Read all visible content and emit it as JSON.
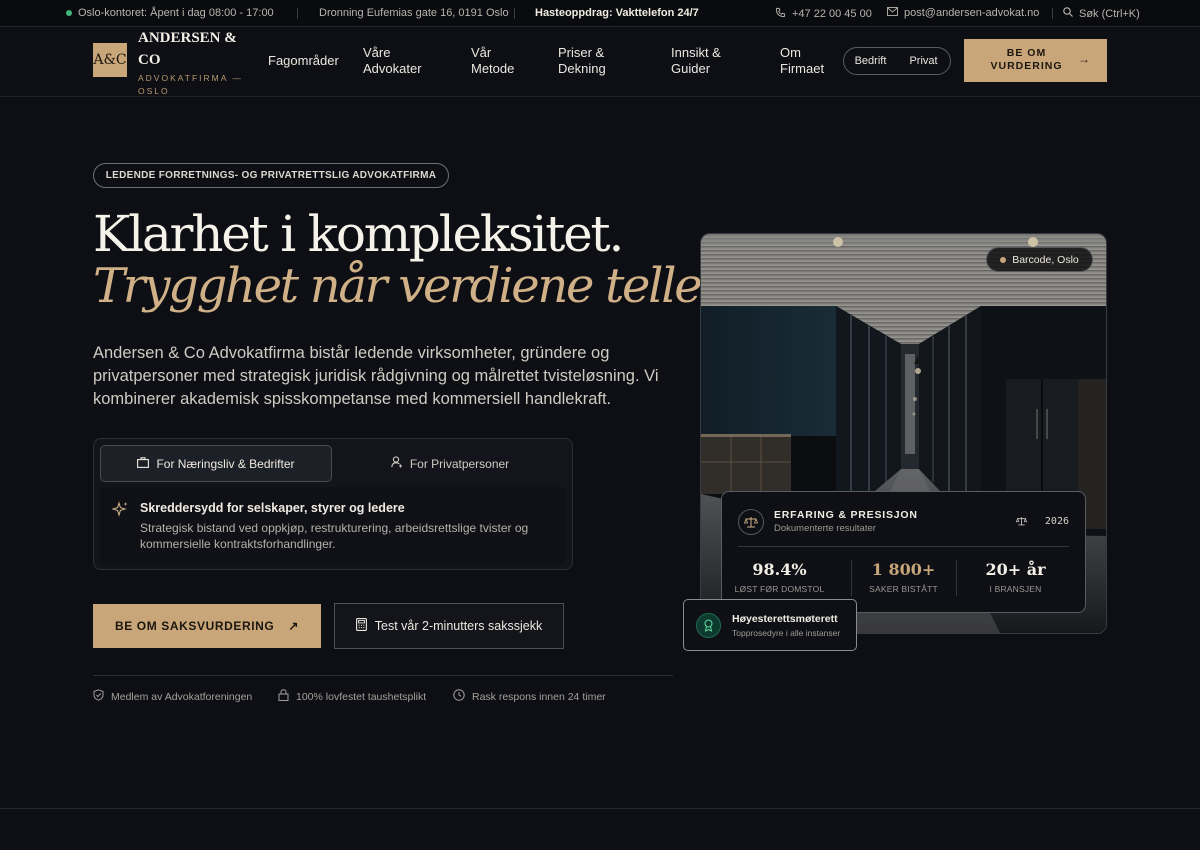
{
  "topbar": {
    "status": "Oslo-kontoret: Åpent i dag 08:00 - 17:00",
    "address": "Dronning Eufemias gate 16, 0191 Oslo",
    "urgent_label": "Hasteoppdrag:",
    "urgent_value": "Vakttelefon 24/7",
    "phone": "+47 22 00 45 00",
    "email": "post@andersen-advokat.no",
    "search": "Søk (Ctrl+K)"
  },
  "brand": {
    "logo_mark": "A&C",
    "name_line1": "ANDERSEN &",
    "name_line2": "CO",
    "tagline": "ADVOKATFIRMA — OSLO"
  },
  "nav": {
    "links": [
      {
        "line1": "Fagområder",
        "line2": ""
      },
      {
        "line1": "Våre",
        "line2": "Advokater"
      },
      {
        "line1": "Vår",
        "line2": "Metode"
      },
      {
        "line1": "Priser &",
        "line2": "Dekning"
      },
      {
        "line1": "Innsikt &",
        "line2": "Guider"
      },
      {
        "line1": "Om",
        "line2": "Firmaet"
      }
    ],
    "segment": {
      "option1": "Bedrift",
      "option2": "Privat"
    },
    "cta_line1": "BE OM",
    "cta_line2": "VURDERING",
    "cta_arrow": "→"
  },
  "hero": {
    "pill": "LEDENDE FORRETNINGS- OG PRIVATRETTSLIG ADVOKATFIRMA",
    "heading": "Klarhet i kompleksitet.",
    "heading_italic": "Trygghet når verdiene teller.",
    "lead": "Andersen & Co Advokatfirma bistår ledende virksomheter, gründere og privatpersoner med strategisk juridisk rådgivning og målrettet tvisteløsning. Vi kombinerer akademisk spisskompetanse med kommersiell handlekraft.",
    "tabs": [
      {
        "label": "For Næringsliv & Bedrifter",
        "icon": "briefcase-icon"
      },
      {
        "label": "For Privatpersoner",
        "icon": "user-icon"
      }
    ],
    "tab_content": {
      "title": "Skreddersydd for selskaper, styrer og ledere",
      "text": "Strategisk bistand ved oppkjøp, restrukturering, arbeidsrettslige tvister og kommersielle kontraktsforhandlinger.",
      "icon": "sparkle-icon"
    },
    "cta_primary": "BE OM SAKSVURDERING",
    "cta_primary_arrow": "↗",
    "cta_secondary": "Test vår 2-minutters sakssjekk",
    "trust": [
      {
        "label": "Medlem av Advokatforeningen",
        "icon": "shield-icon"
      },
      {
        "label": "100% lovfestet taushetsplikt",
        "icon": "lock-icon"
      },
      {
        "label": "Rask respons innen 24 timer",
        "icon": "clock-icon"
      }
    ]
  },
  "photo": {
    "location": "Barcode, Oslo"
  },
  "stats_card": {
    "title": "ERFARING & PRESISJON",
    "subtitle": "Dokumenterte resultater",
    "year": "2026",
    "stats": [
      {
        "value": "98.4%",
        "label": "LØST FØR DOMSTOL"
      },
      {
        "value": "1 800+",
        "label": "SAKER BISTÅTT"
      },
      {
        "value": "20+ år",
        "label": "I BRANSJEN"
      }
    ]
  },
  "badge": {
    "title": "Høyesterettsmøterett",
    "subtitle": "Topprosedyre i alle instanser"
  },
  "colors": {
    "background": "#0e0f15",
    "accent_gold": "#c9a679",
    "status_green": "#3fb67c"
  }
}
